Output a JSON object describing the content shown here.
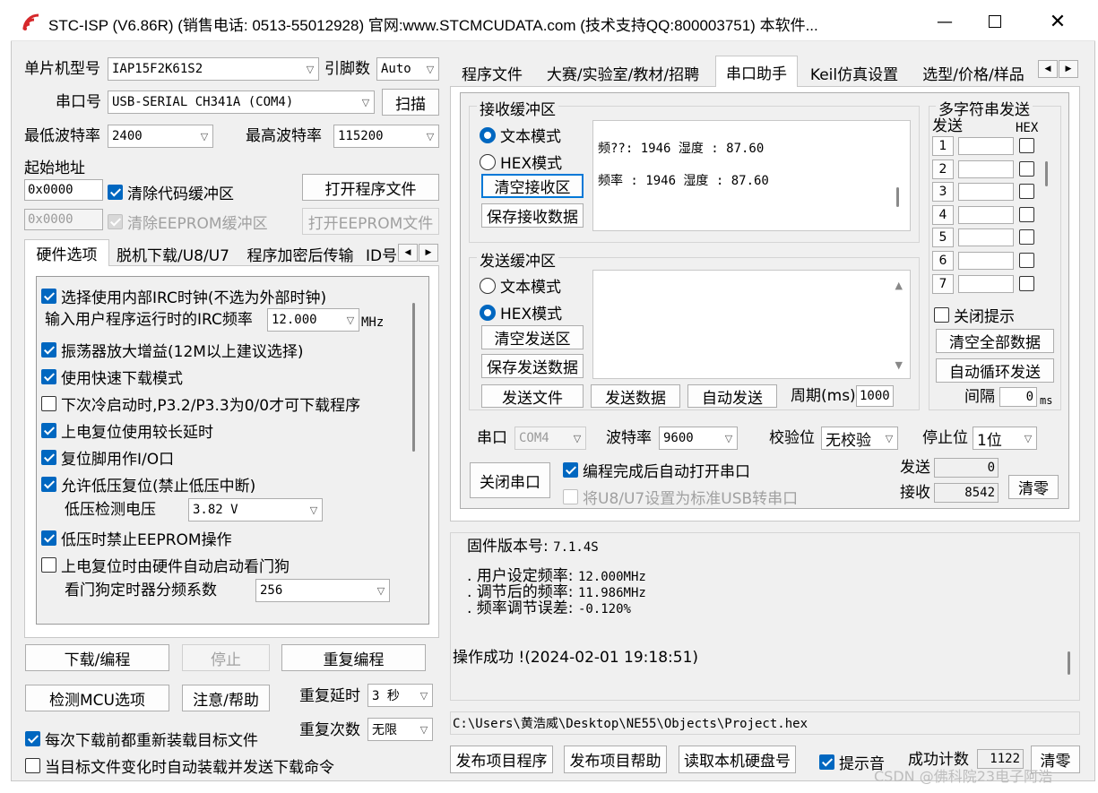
{
  "title": "STC-ISP (V6.86R) (销售电话: 0513-55012928) 官网:www.STCMCUDATA.com  (技术支持QQ:800003751) 本软件...",
  "mcu": {
    "label": "单片机型号",
    "value": "IAP15F2K61S2",
    "pins_label": "引脚数",
    "pins_value": "Auto",
    "port_label": "串口号",
    "port_value": "USB-SERIAL CH341A (COM4)",
    "scan_button": "扫描",
    "min_baud_label": "最低波特率",
    "min_baud_value": "2400",
    "max_baud_label": "最高波特率",
    "max_baud_value": "115200",
    "start_addr_label": "起始地址",
    "addr1": "0x0000",
    "clear_code_label": "清除代码缓冲区",
    "open_prog_button": "打开程序文件",
    "addr2": "0x0000",
    "clear_eeprom_label": "清除EEPROM缓冲区",
    "open_eeprom_button": "打开EEPROM文件"
  },
  "hw_tabs": [
    "硬件选项",
    "脱机下载/U8/U7",
    "程序加密后传输",
    "ID号"
  ],
  "hw_options": {
    "opt1": "选择使用内部IRC时钟(不选为外部时钟)",
    "irc_label": "输入用户程序运行时的IRC频率",
    "irc_value": "12.000",
    "irc_unit": "MHz",
    "opt2": "振荡器放大增益(12M以上建议选择)",
    "opt3": "使用快速下载模式",
    "opt4": "下次冷启动时,P3.2/P3.3为0/0才可下载程序",
    "opt5": "上电复位使用较长延时",
    "opt6": "复位脚用作I/O口",
    "opt7": "允许低压复位(禁止低压中断)",
    "lv_label": "低压检测电压",
    "lv_value": "3.82 V",
    "opt8": "低压时禁止EEPROM操作",
    "opt9": "上电复位时由硬件自动启动看门狗",
    "wdt_label": "看门狗定时器分频系数",
    "wdt_value": "256"
  },
  "bottom_left": {
    "download": "下载/编程",
    "stop": "停止",
    "reprog": "重复编程",
    "detect": "检测MCU选项",
    "help": "注意/帮助",
    "delay_label": "重复延时",
    "delay_value": "3 秒",
    "count_label": "重复次数",
    "count_value": "无限",
    "reload_label": "每次下载前都重新装载目标文件",
    "auto_label": "当目标文件变化时自动装载并发送下载命令"
  },
  "right_tabs": [
    "程序文件",
    "大赛/实验室/教材/招聘",
    "串口助手",
    "Keil仿真设置",
    "选型/价格/样品"
  ],
  "recv": {
    "group": "接收缓冲区",
    "text_mode": "文本模式",
    "hex_mode": "HEX模式",
    "clear": "清空接收区",
    "save": "保存接收数据",
    "line1": "频??: 1946 湿度 : 87.60",
    "line2": "频率 : 1946 湿度 : 87.60"
  },
  "send": {
    "group": "发送缓冲区",
    "text_mode": "文本模式",
    "hex_mode": "HEX模式",
    "clear": "清空发送区",
    "save": "保存发送数据",
    "send_file": "发送文件",
    "send_data": "发送数据",
    "auto_send": "自动发送",
    "period_label": "周期(ms)",
    "period_value": "1000"
  },
  "multi": {
    "group": "多字符串发送",
    "send_col": "发送",
    "hex_col": "HEX",
    "rows": [
      "1",
      "2",
      "3",
      "4",
      "5",
      "6",
      "7"
    ],
    "close_tip": "关闭提示",
    "clear_all": "清空全部数据",
    "auto_loop": "自动循环发送",
    "interval_label": "间隔",
    "interval_value": "0",
    "interval_unit": "ms"
  },
  "serial": {
    "port_label": "串口",
    "port_value": "COM4",
    "baud_label": "波特率",
    "baud_value": "9600",
    "parity_label": "校验位",
    "parity_value": "无校验",
    "stop_label": "停止位",
    "stop_value": "1位",
    "close_port": "关闭串口",
    "auto_open": "编程完成后自动打开串口",
    "usb_convert": "将U8/U7设置为标准USB转串口",
    "sent_label": "发送",
    "sent_value": "0",
    "recv_label": "接收",
    "recv_value": "8542",
    "clear": "清零"
  },
  "log": {
    "fw_label": "固件版本号:",
    "fw_value": "7.1.4S",
    "l1_label": ". 用户设定频率:",
    "l1_value": "12.000MHz",
    "l2_label": ". 调节后的频率:",
    "l2_value": "11.986MHz",
    "l3_label": ". 频率调节误差:",
    "l3_value": "-0.120%",
    "success": "操作成功 !(2024-02-01 19:18:51)"
  },
  "path": "C:\\Users\\黄浩威\\Desktop\\NE55\\Objects\\Project.hex",
  "footer": {
    "publish": "发布项目程序",
    "publish_help": "发布项目帮助",
    "read_disk": "读取本机硬盘号",
    "beep": "提示音",
    "success_count_label": "成功计数",
    "success_count": "1122",
    "clear": "清零"
  },
  "watermark": "CSDN @佛科院23电子阿浩"
}
